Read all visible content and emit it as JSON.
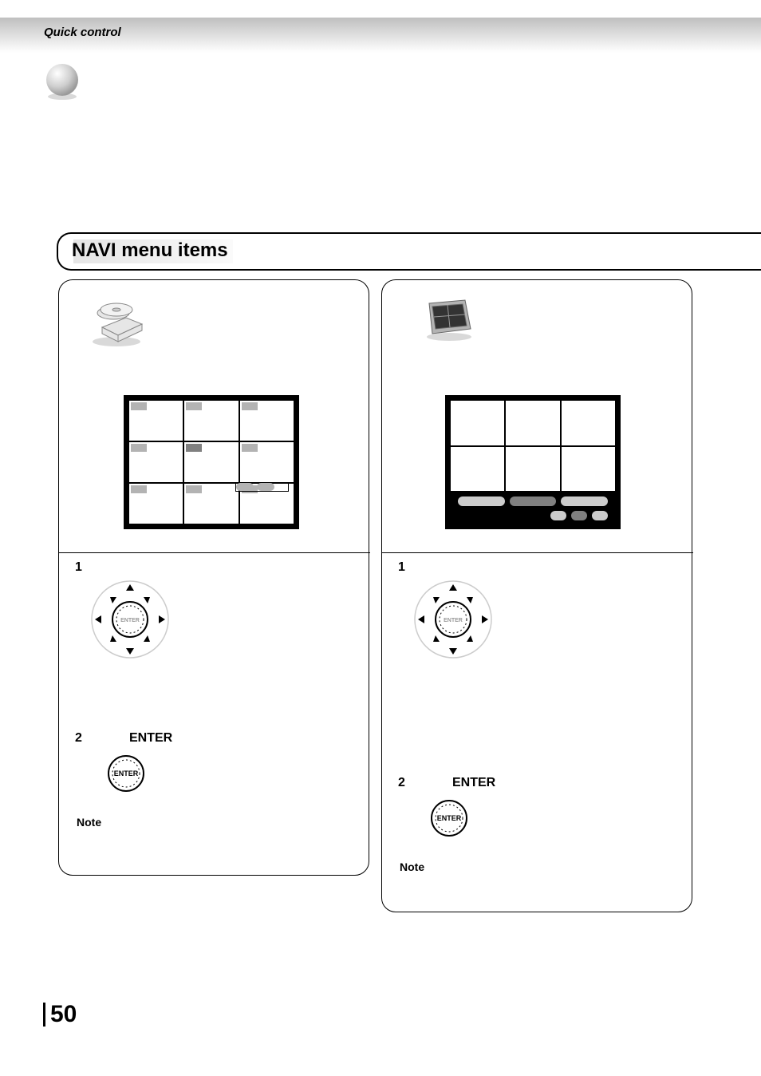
{
  "header": {
    "quick_control": "Quick control"
  },
  "section": {
    "title": "NAVI menu items"
  },
  "panels": {
    "left": {
      "step1_num": "1",
      "step2_num": "2",
      "step2_label": "ENTER",
      "note_label": "Note",
      "dpad_center": "ENTER",
      "enter_btn_label": "ENTER"
    },
    "right": {
      "step1_num": "1",
      "step2_num": "2",
      "step2_label": "ENTER",
      "note_label": "Note",
      "dpad_center": "ENTER",
      "enter_btn_label": "ENTER"
    }
  },
  "page_number": "50"
}
